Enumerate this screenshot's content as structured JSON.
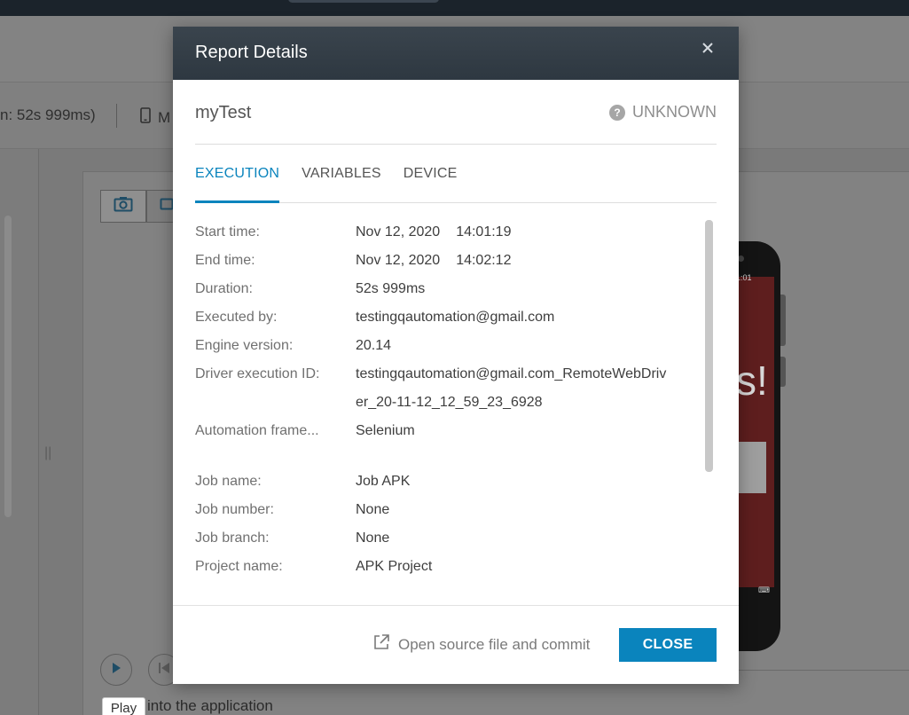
{
  "background": {
    "duration_text": "n: 52s 999ms)",
    "device_text": "M",
    "phone_status_time": "1:01",
    "phone_big_text": "s!",
    "tooltip": "Play",
    "step_text": "into the application"
  },
  "modal": {
    "title": "Report Details",
    "test_name": "myTest",
    "status": "UNKNOWN",
    "tabs": [
      {
        "label": "EXECUTION",
        "active": true
      },
      {
        "label": "VARIABLES",
        "active": false
      },
      {
        "label": "DEVICE",
        "active": false
      }
    ],
    "details": [
      {
        "label": "Start time:",
        "date": "Nov 12, 2020",
        "time": "14:01:19"
      },
      {
        "label": "End time:",
        "date": "Nov 12, 2020",
        "time": "14:02:12"
      },
      {
        "label": "Duration:",
        "value": "52s 999ms"
      },
      {
        "label": "Executed by:",
        "value": "testingqautomation@gmail.com"
      },
      {
        "label": "Engine version:",
        "value": "20.14"
      },
      {
        "label": "Driver execution ID:",
        "value": "testingqautomation@gmail.com_RemoteWebDriv",
        "value_cont": "er_20-11-12_12_59_23_6928"
      },
      {
        "label": "Automation frame...",
        "value": "Selenium"
      },
      {
        "label": "Job name:",
        "value": "Job APK"
      },
      {
        "label": "Job number:",
        "value": "None"
      },
      {
        "label": "Job branch:",
        "value": "None"
      },
      {
        "label": "Project name:",
        "value": "APK Project"
      }
    ],
    "open_source_label": "Open source file and commit",
    "close_label": "CLOSE"
  },
  "colors": {
    "accent": "#0a84bd",
    "header_bg": "#343e47",
    "overlay": "#7a7a7a"
  },
  "icons": [
    "close-icon",
    "question-icon",
    "external-link-icon",
    "camera-icon",
    "video-icon",
    "play-icon",
    "skip-back-icon",
    "mobile-device-icon"
  ]
}
